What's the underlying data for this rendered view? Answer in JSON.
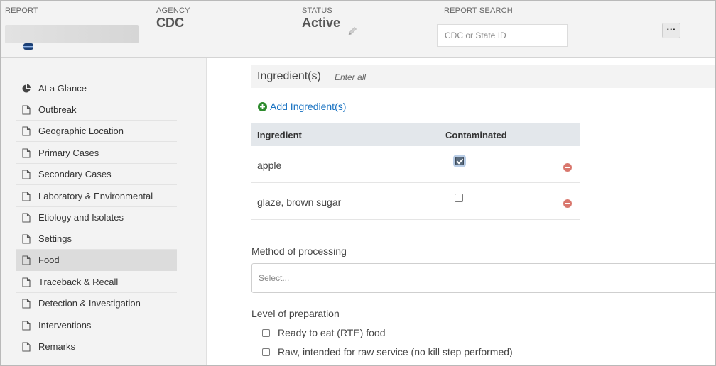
{
  "header": {
    "report_label": "REPORT",
    "agency_label": "AGENCY",
    "agency_value": "CDC",
    "status_label": "STATUS",
    "status_value": "Active",
    "search_label": "REPORT SEARCH",
    "search_placeholder": "CDC or State ID",
    "search_value": "",
    "more_label": "···"
  },
  "sidebar": {
    "items": [
      {
        "label": "At a Glance",
        "icon": "pie-chart-icon",
        "active": false
      },
      {
        "label": "Outbreak",
        "icon": "document-icon",
        "active": false
      },
      {
        "label": "Geographic Location",
        "icon": "document-icon",
        "active": false
      },
      {
        "label": "Primary Cases",
        "icon": "document-icon",
        "active": false
      },
      {
        "label": "Secondary Cases",
        "icon": "document-icon",
        "active": false
      },
      {
        "label": "Laboratory & Environmental",
        "icon": "document-icon",
        "active": false
      },
      {
        "label": "Etiology and Isolates",
        "icon": "document-icon",
        "active": false
      },
      {
        "label": "Settings",
        "icon": "document-icon",
        "active": false
      },
      {
        "label": "Food",
        "icon": "document-icon",
        "active": true
      },
      {
        "label": "Traceback & Recall",
        "icon": "document-icon",
        "active": false
      },
      {
        "label": "Detection & Investigation",
        "icon": "document-icon",
        "active": false
      },
      {
        "label": "Interventions",
        "icon": "document-icon",
        "active": false
      },
      {
        "label": "Remarks",
        "icon": "document-icon",
        "active": false
      }
    ]
  },
  "ingredients": {
    "title": "Ingredient(s)",
    "hint": "Enter all",
    "add_label": "Add Ingredient(s)",
    "columns": [
      "Ingredient",
      "Contaminated"
    ],
    "rows": [
      {
        "name": "apple",
        "contaminated": true
      },
      {
        "name": "glaze, brown sugar",
        "contaminated": false
      }
    ]
  },
  "processing": {
    "label": "Method of processing",
    "placeholder": "Select..."
  },
  "preparation": {
    "label": "Level of preparation",
    "options": [
      {
        "label": "Ready to eat (RTE) food",
        "checked": false
      },
      {
        "label": "Raw, intended for raw service (no kill step performed)",
        "checked": false
      }
    ]
  },
  "colors": {
    "link": "#1a73c2",
    "remove": "#d9776d",
    "active_nav": "#dcdcdc",
    "header_bg": "#f3f3f3"
  }
}
